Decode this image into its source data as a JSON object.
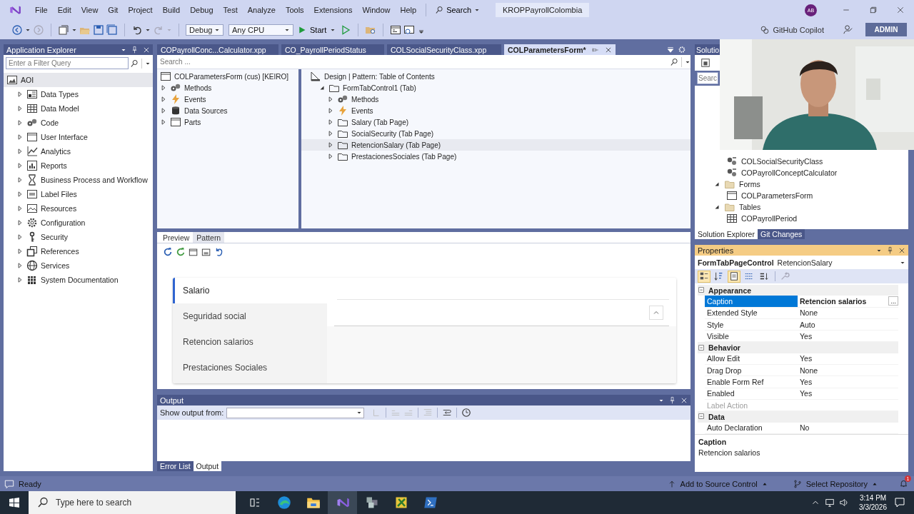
{
  "menu_bar": {
    "items": [
      "File",
      "Edit",
      "View",
      "Git",
      "Project",
      "Build",
      "Debug",
      "Test",
      "Analyze",
      "Tools",
      "Extensions",
      "Window",
      "Help"
    ],
    "search": "Search",
    "solution_name": "KROPPayrollColombia",
    "avatar": "AB"
  },
  "toolbar": {
    "configuration": "Debug",
    "platform": "Any CPU",
    "start": "Start",
    "copilot": "GitHub Copilot",
    "role_badge": "ADMIN"
  },
  "application_explorer": {
    "title": "Application Explorer",
    "filter_placeholder": "Enter a Filter Query",
    "tree": [
      {
        "label": "AOI",
        "kind": "aot",
        "selected": true,
        "children": [
          {
            "label": "Data Types",
            "kind": "types",
            "expanded": false,
            "selected": false
          },
          {
            "label": "Data Model",
            "kind": "model",
            "expanded": false,
            "selected": false
          },
          {
            "label": "Code",
            "kind": "code",
            "expanded": false,
            "selected": false
          },
          {
            "label": "User Interface",
            "kind": "ui",
            "expanded": false,
            "selected": false
          },
          {
            "label": "Analytics",
            "kind": "analytics",
            "expanded": false,
            "selected": false
          },
          {
            "label": "Reports",
            "kind": "reports",
            "expanded": false,
            "selected": false
          },
          {
            "label": "Business Process and Workflow",
            "kind": "workflow",
            "expanded": false,
            "selected": false
          },
          {
            "label": "Label Files",
            "kind": "labels",
            "expanded": false,
            "selected": false
          },
          {
            "label": "Resources",
            "kind": "resources",
            "expanded": false,
            "selected": false
          },
          {
            "label": "Configuration",
            "kind": "configuration",
            "expanded": false,
            "selected": false
          },
          {
            "label": "Security",
            "kind": "security",
            "expanded": false,
            "selected": false
          },
          {
            "label": "References",
            "kind": "references",
            "expanded": false,
            "selected": false
          },
          {
            "label": "Services",
            "kind": "services",
            "expanded": false,
            "selected": false
          },
          {
            "label": "System Documentation",
            "kind": "documentation",
            "expanded": false,
            "selected": false
          }
        ]
      }
    ]
  },
  "editor": {
    "tabs": [
      {
        "label": "COPayrollConc...Calculator.xpp",
        "selected": false
      },
      {
        "label": "CO_PayrollPeriodStatus",
        "selected": false
      },
      {
        "label": "COLSocialSecurityClass.xpp",
        "selected": false
      },
      {
        "label": "COLParametersForm*",
        "selected": true
      }
    ],
    "search_placeholder": "Search ...",
    "form_tree": [
      {
        "label": "COLParametersForm (cus) [KEIRO]",
        "kind": "form",
        "selected": false,
        "children": [
          {
            "label": "Methods",
            "kind": "methods",
            "expanded": false,
            "selected": false
          },
          {
            "label": "Events",
            "kind": "events",
            "expanded": false,
            "selected": false
          },
          {
            "label": "Data Sources",
            "kind": "datasources",
            "expanded": false,
            "selected": false
          },
          {
            "label": "Parts",
            "kind": "form",
            "expanded": false,
            "selected": false
          }
        ]
      }
    ],
    "design_tree": [
      {
        "label": "Design | Pattern: Table of Contents",
        "kind": "design",
        "selected": false,
        "children": [
          {
            "label": "FormTabControl1 (Tab)",
            "kind": "folder",
            "expanded": true,
            "selected": false,
            "children": [
              {
                "label": "Methods",
                "kind": "methods",
                "expanded": false,
                "selected": false
              },
              {
                "label": "Events",
                "kind": "events",
                "expanded": false,
                "selected": false
              },
              {
                "label": "Salary (Tab Page)",
                "kind": "folder",
                "expanded": false,
                "selected": false
              },
              {
                "label": "SocialSecurity (Tab Page)",
                "kind": "folder",
                "expanded": false,
                "selected": false
              },
              {
                "label": "RetencionSalary (Tab Page)",
                "kind": "folder",
                "expanded": false,
                "selected": true
              },
              {
                "label": "PrestacionesSociales (Tab Page)",
                "kind": "folder",
                "expanded": false,
                "selected": false
              }
            ]
          }
        ]
      }
    ],
    "preview": {
      "tabs": [
        {
          "label": "Preview",
          "selected": true
        },
        {
          "label": "Pattern",
          "selected": false
        }
      ],
      "form_tabs": [
        {
          "label": "Salario",
          "selected": true
        },
        {
          "label": "Seguridad social",
          "selected": false
        },
        {
          "label": "Retencion salarios",
          "selected": false
        },
        {
          "label": "Prestaciones Sociales",
          "selected": false
        }
      ]
    }
  },
  "output": {
    "title": "Output",
    "source_label": "Show output from:",
    "tabs": [
      {
        "label": "Error List",
        "selected": false
      },
      {
        "label": "Output",
        "selected": true
      }
    ]
  },
  "solution_explorer": {
    "title": "Solutio",
    "search_placeholder": "Searc",
    "tree": [
      {
        "children": [
          {
            "label": "COLSocialSecurityClass",
            "kind": "class",
            "selected": false
          },
          {
            "label": "COPayrollConceptCalculator",
            "kind": "class",
            "selected": false
          }
        ]
      },
      {
        "label": "Forms",
        "kind": "openfolder",
        "expanded": true,
        "selected": false,
        "children": [
          {
            "label": "COLParametersForm",
            "kind": "form",
            "selected": false
          }
        ]
      },
      {
        "label": "Tables",
        "kind": "openfolder",
        "expanded": true,
        "selected": false,
        "children": [
          {
            "label": "COPayrollPeriod",
            "kind": "table",
            "selected": false
          }
        ]
      }
    ],
    "tabs": [
      {
        "label": "Solution Explorer",
        "selected": true
      },
      {
        "label": "Git Changes",
        "selected": false
      }
    ]
  },
  "properties": {
    "title": "Properties",
    "object_type": "FormTabPageControl",
    "object_name": "RetencionSalary",
    "toolbar": [
      {
        "on": true
      },
      {
        "on": false
      },
      {
        "on": true
      },
      {
        "on": false
      },
      {
        "on": false
      }
    ],
    "categories": [
      {
        "name": "Appearance",
        "expanded": true,
        "rows": [
          {
            "name": "Caption",
            "value": "Retencion salarios",
            "button": "...",
            "selected": true,
            "modified": true,
            "disabled": false
          },
          {
            "name": "Extended Style",
            "value": "None",
            "selected": false,
            "modified": false,
            "disabled": false
          },
          {
            "name": "Style",
            "value": "Auto",
            "selected": false,
            "modified": false,
            "disabled": false
          },
          {
            "name": "Visible",
            "value": "Yes",
            "selected": false,
            "modified": false,
            "disabled": false
          }
        ]
      },
      {
        "name": "Behavior",
        "expanded": true,
        "rows": [
          {
            "name": "Allow Edit",
            "value": "Yes",
            "selected": false,
            "modified": false,
            "disabled": false
          },
          {
            "name": "Drag Drop",
            "value": "None",
            "selected": false,
            "modified": false,
            "disabled": false
          },
          {
            "name": "Enable Form Ref",
            "value": "Yes",
            "selected": false,
            "modified": false,
            "disabled": false
          },
          {
            "name": "Enabled",
            "value": "Yes",
            "selected": false,
            "modified": false,
            "disabled": false
          },
          {
            "name": "Label Action",
            "selected": false,
            "disabled": true
          }
        ]
      },
      {
        "name": "Data",
        "expanded": true,
        "rows": [
          {
            "name": "Auto Declaration",
            "value": "No",
            "selected": false,
            "modified": false,
            "disabled": false
          }
        ]
      }
    ],
    "description_title": "Caption",
    "description_text": "Retencion salarios"
  },
  "status_bar": {
    "text": "Ready",
    "source_control": "Add to Source Control",
    "repository": "Select Repository",
    "notifications": "1"
  },
  "taskbar": {
    "search_placeholder": "Type here to search",
    "time": "3:14 PM",
    "date": "3/3/2026"
  }
}
